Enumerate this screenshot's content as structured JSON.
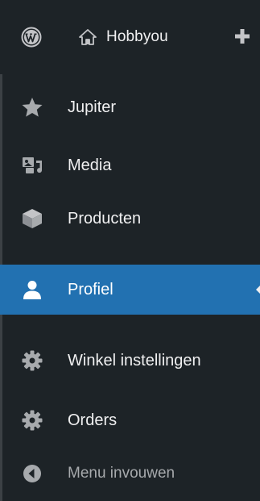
{
  "adminbar": {
    "site_name": "Hobbyou",
    "icons": [
      "wordpress-logo-icon",
      "home-icon",
      "plus-icon"
    ]
  },
  "menu": {
    "items": [
      {
        "label": "Jupiter",
        "icon": "star-icon"
      },
      {
        "label": "Media",
        "icon": "media-icon"
      },
      {
        "label": "Producten",
        "icon": "product-box-icon"
      },
      {
        "label": "Profiel",
        "icon": "user-icon",
        "current": true
      },
      {
        "label": "Winkel instellingen",
        "icon": "gear-icon"
      },
      {
        "label": "Orders",
        "icon": "gear-icon"
      },
      {
        "label": "Menu invouwen",
        "icon": "collapse-arrow-icon"
      }
    ]
  },
  "colors": {
    "background": "#1d2327",
    "text": "#f0f0f1",
    "muted_text": "#a7aaad",
    "accent": "#2271b1"
  }
}
